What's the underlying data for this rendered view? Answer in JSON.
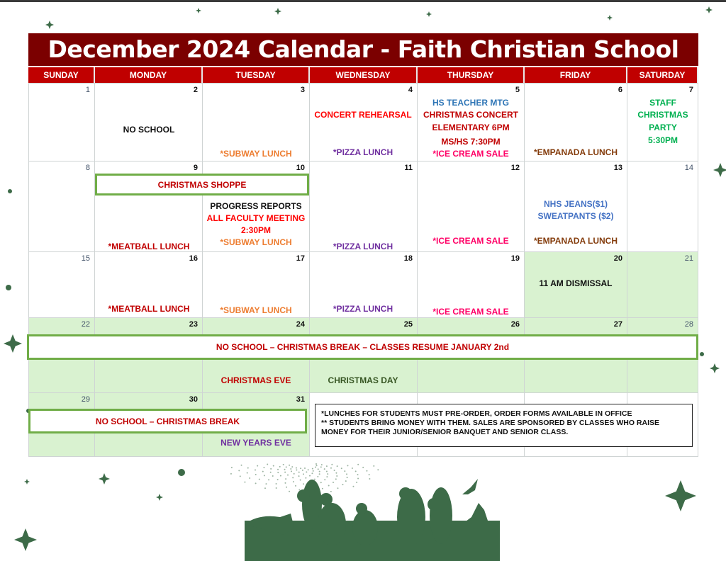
{
  "title": "December 2024 Calendar - Faith Christian School",
  "weekdays": [
    "SUNDAY",
    "MONDAY",
    "TUESDAY",
    "WEDNESDAY",
    "THURSDAY",
    "FRIDAY",
    "SATURDAY"
  ],
  "days": [
    "1",
    "2",
    "3",
    "4",
    "5",
    "6",
    "7",
    "8",
    "9",
    "10",
    "11",
    "12",
    "13",
    "14",
    "15",
    "16",
    "17",
    "18",
    "19",
    "20",
    "21",
    "22",
    "23",
    "24",
    "25",
    "26",
    "27",
    "28",
    "29",
    "30",
    "31"
  ],
  "colors": {
    "title_bg": "#7b0000",
    "header_bg": "#c00000",
    "break_bg": "#d9f2d0",
    "banner_border": "#70ad47"
  },
  "events": [
    {
      "day": "2",
      "text": "NO SCHOOL",
      "color": "#111111"
    },
    {
      "day": "3",
      "text": "*SUBWAY LUNCH",
      "color": "#ed7d31"
    },
    {
      "day": "4",
      "text": "CONCERT REHEARSAL",
      "color": "#ff0000"
    },
    {
      "day": "4",
      "text": "*PIZZA LUNCH",
      "color": "#7030a0"
    },
    {
      "day": "5",
      "text": "HS TEACHER MTG",
      "color": "#2e75b6"
    },
    {
      "day": "5",
      "text": "CHRISTMAS CONCERT",
      "color": "#c00000"
    },
    {
      "day": "5",
      "text": "ELEMENTARY 6PM",
      "color": "#c00000"
    },
    {
      "day": "5",
      "text": "MS/HS 7:30PM",
      "color": "#c00000"
    },
    {
      "day": "5",
      "text": "*ICE CREAM SALE",
      "color": "#ff0066"
    },
    {
      "day": "6",
      "text": "*EMPANADA LUNCH",
      "color": "#843c0c"
    },
    {
      "day": "7",
      "text": "STAFF",
      "color": "#00b050"
    },
    {
      "day": "7",
      "text": "CHRISTMAS",
      "color": "#00b050"
    },
    {
      "day": "7",
      "text": "PARTY",
      "color": "#00b050"
    },
    {
      "day": "7",
      "text": "5:30PM",
      "color": "#00b050"
    },
    {
      "day": "9",
      "text": "*MEATBALL LUNCH",
      "color": "#c00000"
    },
    {
      "day": "10",
      "text": "PROGRESS REPORTS",
      "color": "#111111"
    },
    {
      "day": "10",
      "text": "ALL FACULTY MEETING",
      "color": "#ff0000"
    },
    {
      "day": "10",
      "text": "2:30PM",
      "color": "#ff0000"
    },
    {
      "day": "10",
      "text": "*SUBWAY LUNCH",
      "color": "#ed7d31"
    },
    {
      "day": "11",
      "text": "*PIZZA LUNCH",
      "color": "#7030a0"
    },
    {
      "day": "12",
      "text": "*ICE CREAM SALE",
      "color": "#ff0066"
    },
    {
      "day": "13",
      "text": "NHS JEANS($1)",
      "color": "#4472c4"
    },
    {
      "day": "13",
      "text": "SWEATPANTS ($2)",
      "color": "#4472c4"
    },
    {
      "day": "13",
      "text": "*EMPANADA LUNCH",
      "color": "#843c0c"
    },
    {
      "day": "16",
      "text": "*MEATBALL LUNCH",
      "color": "#c00000"
    },
    {
      "day": "17",
      "text": "*SUBWAY LUNCH",
      "color": "#ed7d31"
    },
    {
      "day": "18",
      "text": "*PIZZA LUNCH",
      "color": "#7030a0"
    },
    {
      "day": "19",
      "text": "*ICE CREAM SALE",
      "color": "#ff0066"
    },
    {
      "day": "20",
      "text": "11 AM DISMISSAL",
      "color": "#111111"
    },
    {
      "day": "24",
      "text": "CHRISTMAS EVE",
      "color": "#c00000"
    },
    {
      "day": "25",
      "text": "CHRISTMAS DAY",
      "color": "#375623"
    },
    {
      "day": "31",
      "text": "NEW YEARS EVE",
      "color": "#7030a0"
    }
  ],
  "banners": [
    "CHRISTMAS SHOPPE",
    "NO SCHOOL – CHRISTMAS BREAK – CLASSES RESUME JANUARY 2nd",
    "NO SCHOOL – CHRISTMAS BREAK"
  ],
  "notes": [
    "*LUNCHES FOR STUDENTS MUST PRE-ORDER, ORDER FORMS AVAILABLE IN OFFICE",
    "** STUDENTS BRING MONEY WITH THEM. SALES ARE SPONSORED BY CLASSES WHO RAISE MONEY FOR THEIR JUNIOR/SENIOR BANQUET AND SENIOR CLASS."
  ]
}
